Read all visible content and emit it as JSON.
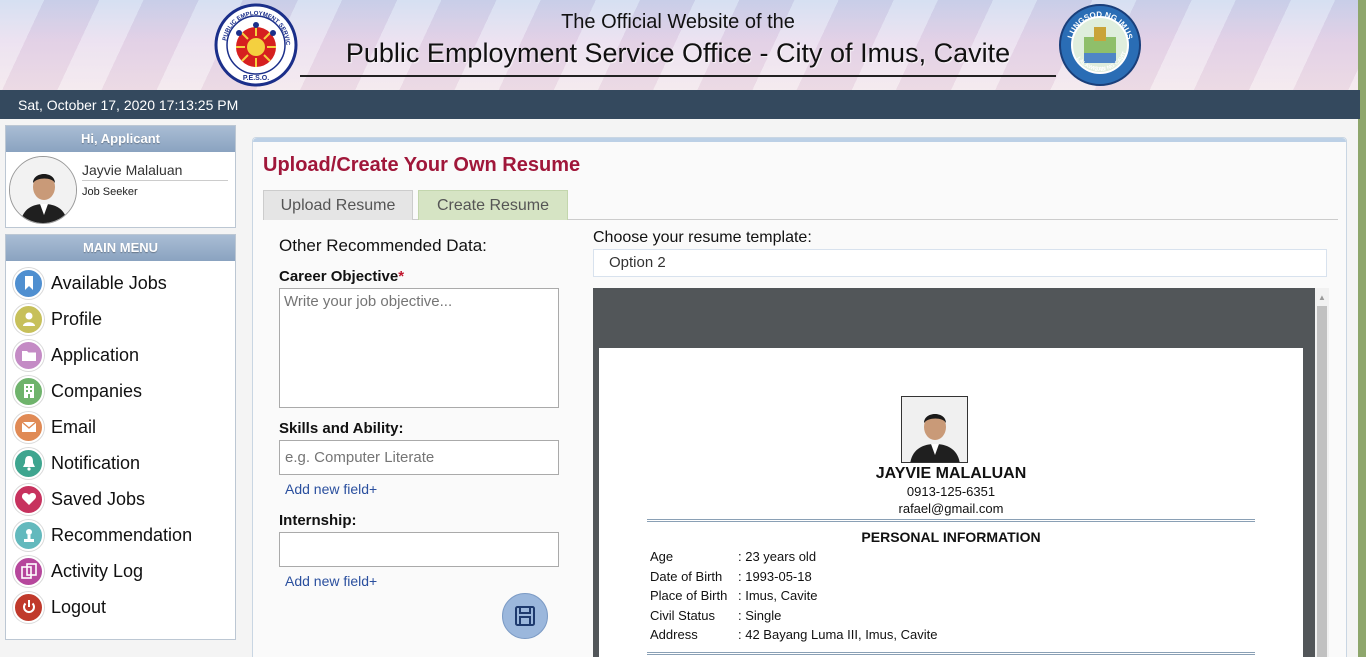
{
  "header": {
    "line1": "The Official Website of the",
    "line2": "Public Employment Service Office - City of Imus, Cavite",
    "peso_logo_text": "PUBLIC EMPLOYMENT SERVICE OFFICE P.E.S.O.",
    "imus_logo_text": "LUNGSOD NG IMUS LALAWIGAN NG CAVITE 2012"
  },
  "datebar": {
    "datetime": "Sat, October 17, 2020 17:13:25 PM"
  },
  "user": {
    "greeting": "Hi, Applicant",
    "name": "Jayvie Malaluan",
    "role": "Job Seeker"
  },
  "menu": {
    "title": "MAIN MENU",
    "items": [
      {
        "label": "Available Jobs",
        "icon": "bookmark-icon",
        "color": "#4f8fd0"
      },
      {
        "label": "Profile",
        "icon": "user-icon",
        "color": "#c7c05a"
      },
      {
        "label": "Application",
        "icon": "folder-icon",
        "color": "#c48bc5"
      },
      {
        "label": "Companies",
        "icon": "building-icon",
        "color": "#6fb36c"
      },
      {
        "label": "Email",
        "icon": "envelope-icon",
        "color": "#e08a55"
      },
      {
        "label": "Notification",
        "icon": "bell-icon",
        "color": "#3ea58f"
      },
      {
        "label": "Saved Jobs",
        "icon": "heart-icon",
        "color": "#c7325e"
      },
      {
        "label": "Recommendation",
        "icon": "award-icon",
        "color": "#63b9bd"
      },
      {
        "label": "Activity Log",
        "icon": "copy-icon",
        "color": "#b6479c"
      },
      {
        "label": "Logout",
        "icon": "power-icon",
        "color": "#c0392b"
      }
    ]
  },
  "main": {
    "title": "Upload/Create Your Own Resume",
    "tabs": [
      {
        "label": "Upload Resume"
      },
      {
        "label": "Create Resume"
      }
    ],
    "section_heading": "Other Recommended Data:",
    "career_objective": {
      "label": "Career Objective",
      "required_mark": "*",
      "placeholder": "Write your job objective..."
    },
    "skills": {
      "label": "Skills and Ability:",
      "placeholder": "e.g. Computer Literate",
      "add_link": "Add new field+"
    },
    "internship": {
      "label": "Internship:",
      "placeholder": "",
      "add_link": "Add new field+"
    },
    "template": {
      "label": "Choose your resume template:",
      "selected": "Option 2"
    }
  },
  "resume": {
    "name": "JAYVIE MALALUAN",
    "phone": "0913-125-6351",
    "email": "rafael@gmail.com",
    "section_title": "PERSONAL INFORMATION",
    "rows": [
      {
        "key": "Age",
        "value": ": 23 years old"
      },
      {
        "key": "Date of Birth",
        "value": ": 1993-05-18"
      },
      {
        "key": "Place of Birth",
        "value": ": Imus, Cavite"
      },
      {
        "key": "Civil Status",
        "value": ": Single"
      },
      {
        "key": "Address",
        "value": ": 42 Bayang Luma III, Imus, Cavite"
      }
    ]
  }
}
